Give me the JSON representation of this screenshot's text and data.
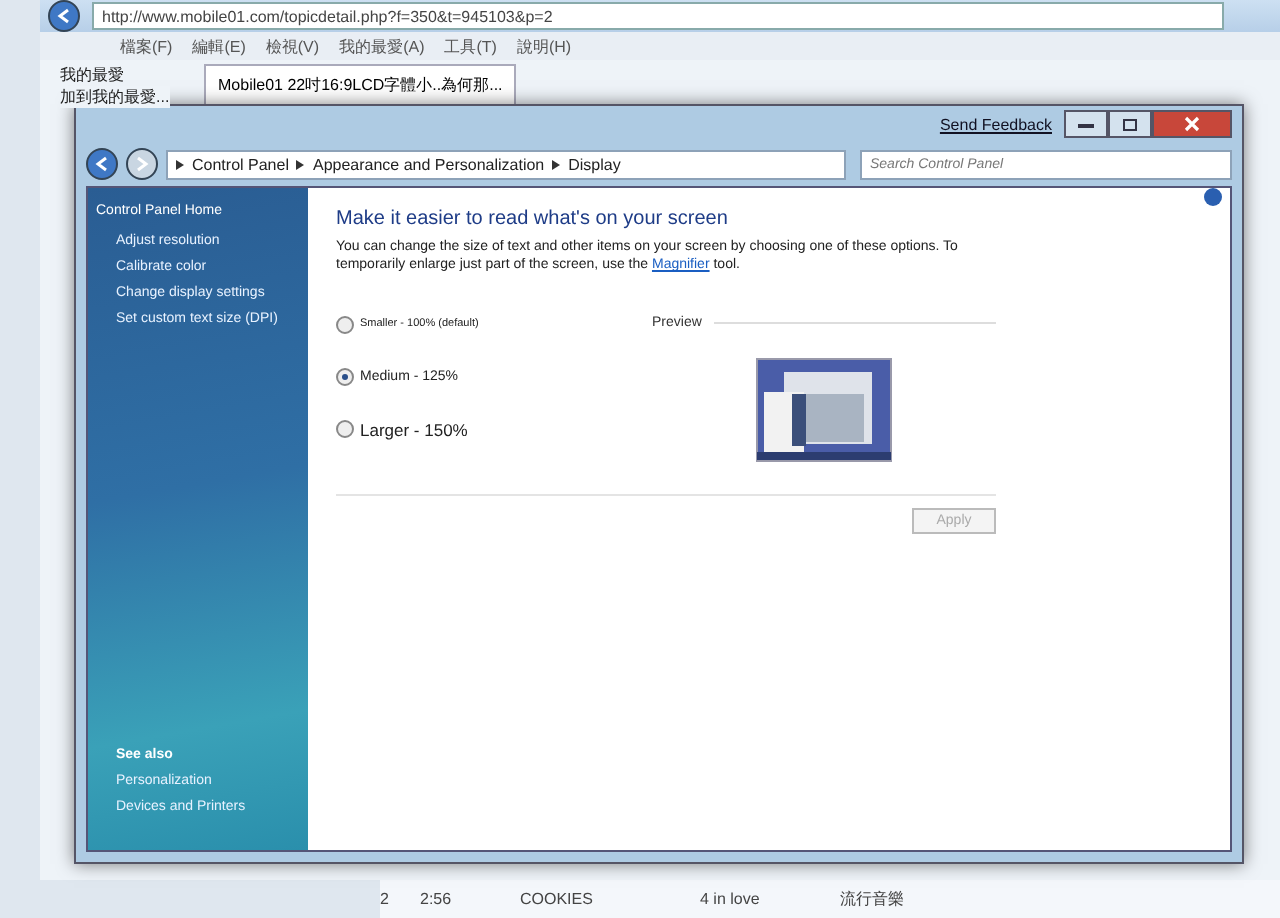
{
  "browser": {
    "address": "http://www.mobile01.com/topicdetail.php?f=350&t=945103&p=2",
    "menu": [
      "檔案(F)",
      "編輯(E)",
      "檢視(V)",
      "我的最愛(A)",
      "工具(T)",
      "說明(H)"
    ],
    "favorites_label": "我的最愛",
    "add_favorites": "加到我的最愛...",
    "tab": {
      "title": "Mobile01 22吋16:9LCD字體小..為何那...",
      "selected": true
    }
  },
  "window": {
    "feedback_link": "Send Feedback",
    "breadcrumb": [
      "Control Panel",
      "Appearance and Personalization",
      "Display"
    ],
    "search": {
      "placeholder": "Search Control Panel"
    }
  },
  "sidebar": {
    "home": "Control Panel Home",
    "links": [
      "Adjust resolution",
      "Calibrate color",
      "Change display settings",
      "Set custom text size (DPI)"
    ],
    "see_also_title": "See also",
    "see_also": [
      "Personalization",
      "Devices and Printers"
    ]
  },
  "content": {
    "heading": "Make it easier to read what's on your screen",
    "description_before": "You can change the size of text and other items on your screen by choosing one of these options. To temporarily enlarge just part of the screen, use the",
    "description_link": "Magnifier",
    "description_after": "tool.",
    "options": [
      {
        "label": "Smaller - 100% (default)",
        "kind": "small",
        "selected": false
      },
      {
        "label": "Medium - 125%",
        "kind": "medium",
        "selected": true
      },
      {
        "label": "Larger - 150%",
        "kind": "large",
        "selected": false
      }
    ],
    "preview_label": "Preview",
    "apply": {
      "label": "Apply",
      "disabled": true
    }
  },
  "player_row": {
    "number": "2",
    "time": "2:56",
    "artist": "COOKIES",
    "album": "4 in love",
    "genre": "流行音樂"
  }
}
